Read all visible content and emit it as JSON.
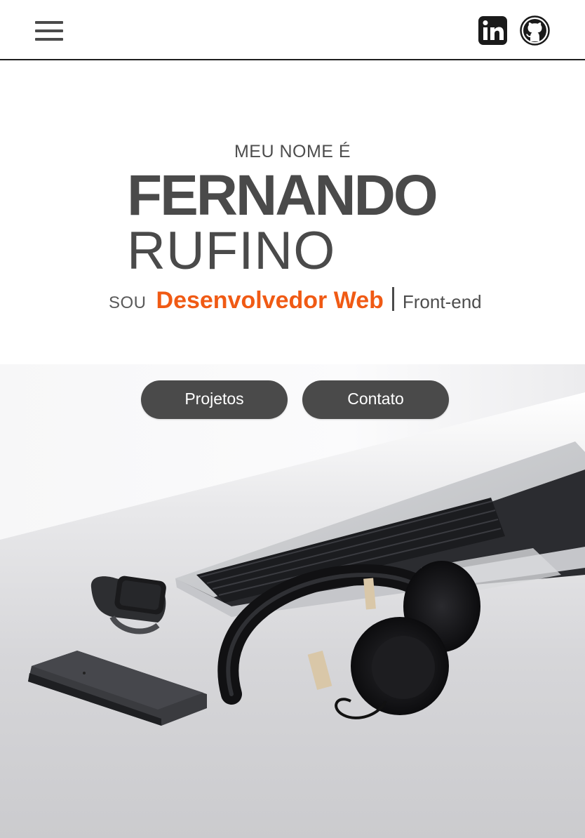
{
  "header": {
    "menu_icon": "hamburger-menu-icon",
    "social": [
      {
        "name": "linkedin-icon",
        "label": "in"
      },
      {
        "name": "github-icon"
      }
    ]
  },
  "hero": {
    "intro": "MEU NOME É",
    "first_name": "FERNANDO",
    "last_name": "RUFINO",
    "role_prefix": "SOU",
    "role": "Desenvolvedor Web",
    "role_sub": "Front-end"
  },
  "buttons": {
    "projects": "Projetos",
    "contact": "Contato"
  },
  "colors": {
    "accent": "#f05a14",
    "text_dark": "#4a4a4a",
    "button_bg": "#4a4a4a"
  }
}
